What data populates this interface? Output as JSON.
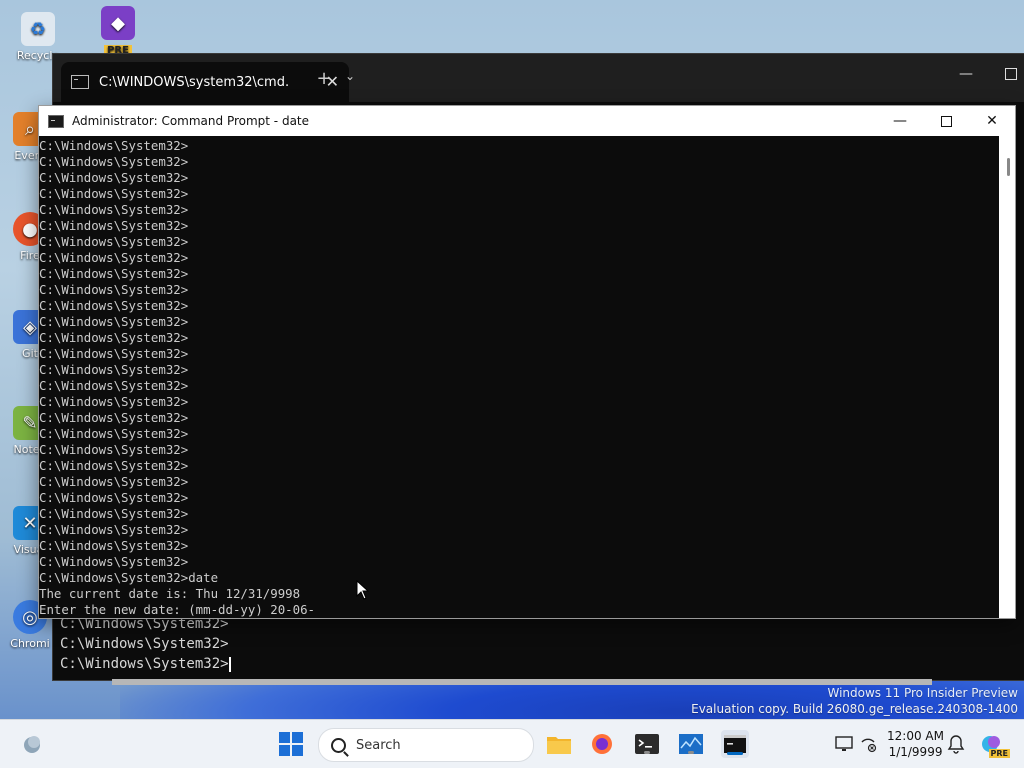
{
  "desktop": {
    "icons": [
      {
        "label": "Recycle"
      },
      {
        "label": "Every"
      },
      {
        "label": "Fire"
      },
      {
        "label": "Git"
      },
      {
        "label": "Notep"
      },
      {
        "label": "Visual"
      },
      {
        "label": "Chromi"
      }
    ],
    "pre_badge": "PRE"
  },
  "terminal": {
    "tab_title": "C:\\WINDOWS\\system32\\cmd.",
    "new_tab": "+",
    "tab_dropdown": "⌄",
    "lines": [
      "C:\\Windows\\System32>",
      "C:\\Windows\\System32>",
      "C:\\Windows\\System32>"
    ]
  },
  "cmd": {
    "title": "Administrator: Command Prompt - date",
    "prompt_line": "C:\\Windows\\System32>",
    "prompt_repeat": 27,
    "command_line": "C:\\Windows\\System32>date",
    "current_date_line": "The current date is: Thu 12/31/9998",
    "new_date_line": "Enter the new date: (mm-dd-yy) 20-06-"
  },
  "watermark": {
    "line1": "Windows 11 Pro Insider Preview",
    "line2": "Evaluation copy. Build 26080.ge_release.240308-1400"
  },
  "taskbar": {
    "search_placeholder": "Search",
    "time": "12:00 AM",
    "date": "1/1/9999",
    "copilot_badge": "PRE"
  }
}
